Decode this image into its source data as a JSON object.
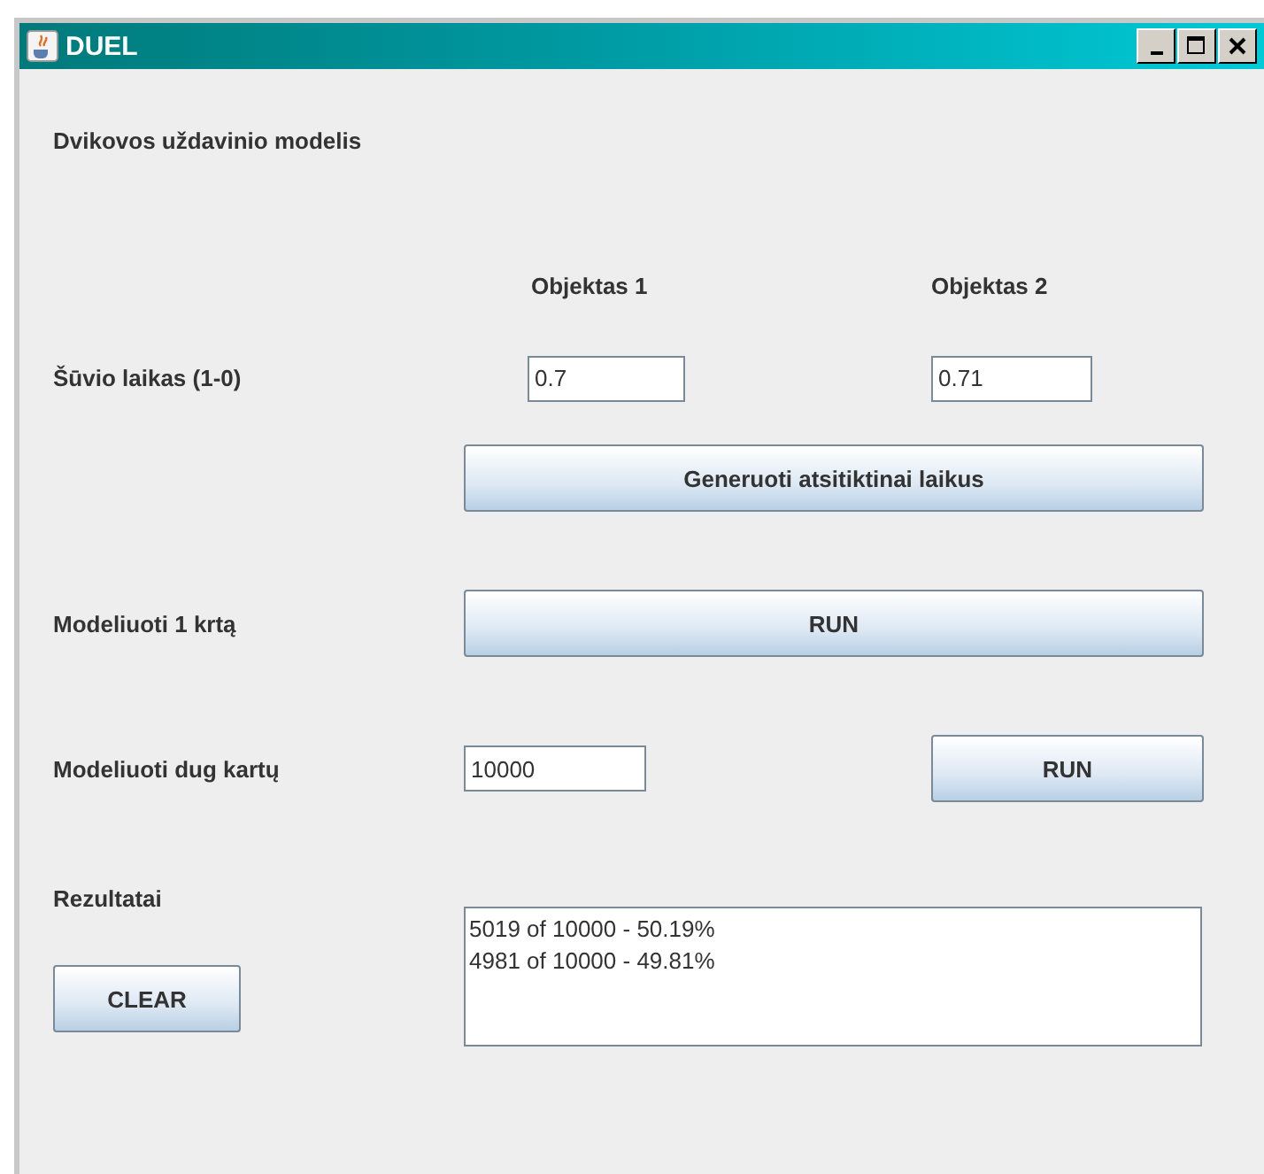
{
  "window": {
    "title": "DUEL"
  },
  "heading": "Dvikovos uždavinio modelis",
  "columns": [
    "Objektas 1",
    "Objektas 2"
  ],
  "shot_time": {
    "label": "Šūvio laikas (1-0)",
    "values": [
      "0.7",
      "0.71"
    ]
  },
  "generate_button": "Generuoti atsitiktinai laikus",
  "run_once": {
    "label": "Modeliuoti 1 krtą",
    "button": "RUN"
  },
  "run_many": {
    "label": "Modeliuoti dug kartų",
    "value": "10000",
    "button": "RUN"
  },
  "results": {
    "label": "Rezultatai",
    "lines": [
      "5019 of 10000 - 50.19%",
      "4981 of 10000 - 49.81%"
    ],
    "clear_button": "CLEAR"
  }
}
